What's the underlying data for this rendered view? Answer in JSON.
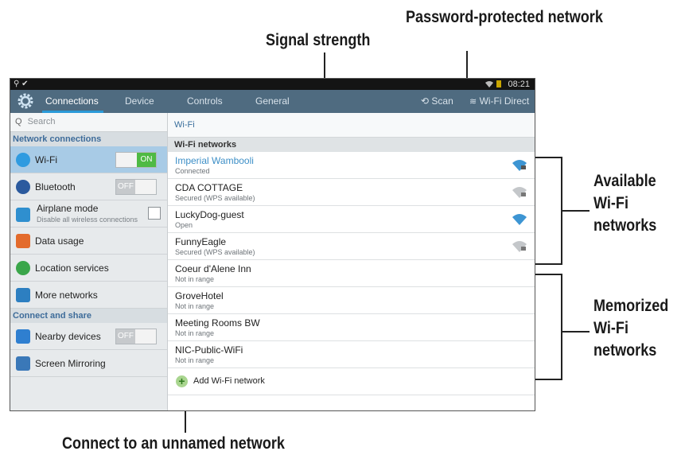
{
  "callouts": {
    "password_protected": "Password-protected network",
    "signal_strength": "Signal strength",
    "available": "Available Wi-Fi networks",
    "memorized": "Memorized Wi-Fi networks",
    "unnamed": "Connect to an unnamed network"
  },
  "status_bar": {
    "time": "08:21"
  },
  "tabs": [
    {
      "label": "Connections",
      "active": true
    },
    {
      "label": "Device",
      "active": false
    },
    {
      "label": "Controls",
      "active": false
    },
    {
      "label": "General",
      "active": false
    }
  ],
  "actions": {
    "scan": "Scan",
    "wifi_direct": "Wi-Fi Direct"
  },
  "sidebar": {
    "search_placeholder": "Search",
    "section_network": "Network connections",
    "section_connect": "Connect and share",
    "items": [
      {
        "label": "Wi-Fi",
        "toggle": "ON"
      },
      {
        "label": "Bluetooth",
        "toggle": "OFF"
      },
      {
        "label": "Airplane mode",
        "sub": "Disable all wireless connections"
      },
      {
        "label": "Data usage"
      },
      {
        "label": "Location services"
      },
      {
        "label": "More networks"
      },
      {
        "label": "Nearby devices",
        "toggle": "OFF"
      },
      {
        "label": "Screen Mirroring"
      }
    ]
  },
  "main": {
    "title": "Wi-Fi",
    "section": "Wi-Fi networks",
    "networks": [
      {
        "name": "Imperial Wambooli",
        "status": "Connected"
      },
      {
        "name": "CDA COTTAGE",
        "status": "Secured (WPS available)"
      },
      {
        "name": "LuckyDog-guest",
        "status": "Open"
      },
      {
        "name": "FunnyEagle",
        "status": "Secured (WPS available)"
      },
      {
        "name": "Coeur d'Alene Inn",
        "status": "Not in range"
      },
      {
        "name": "GroveHotel",
        "status": "Not in range"
      },
      {
        "name": "Meeting Rooms BW",
        "status": "Not in range"
      },
      {
        "name": "NIC-Public-WiFi",
        "status": "Not in range"
      }
    ],
    "add_network": "Add Wi-Fi network"
  },
  "colors": {
    "tab_bar": "#4f6b80",
    "accent": "#2a9ad8",
    "toggle_on": "#4fba44",
    "connected_text": "#3d8fc7"
  }
}
